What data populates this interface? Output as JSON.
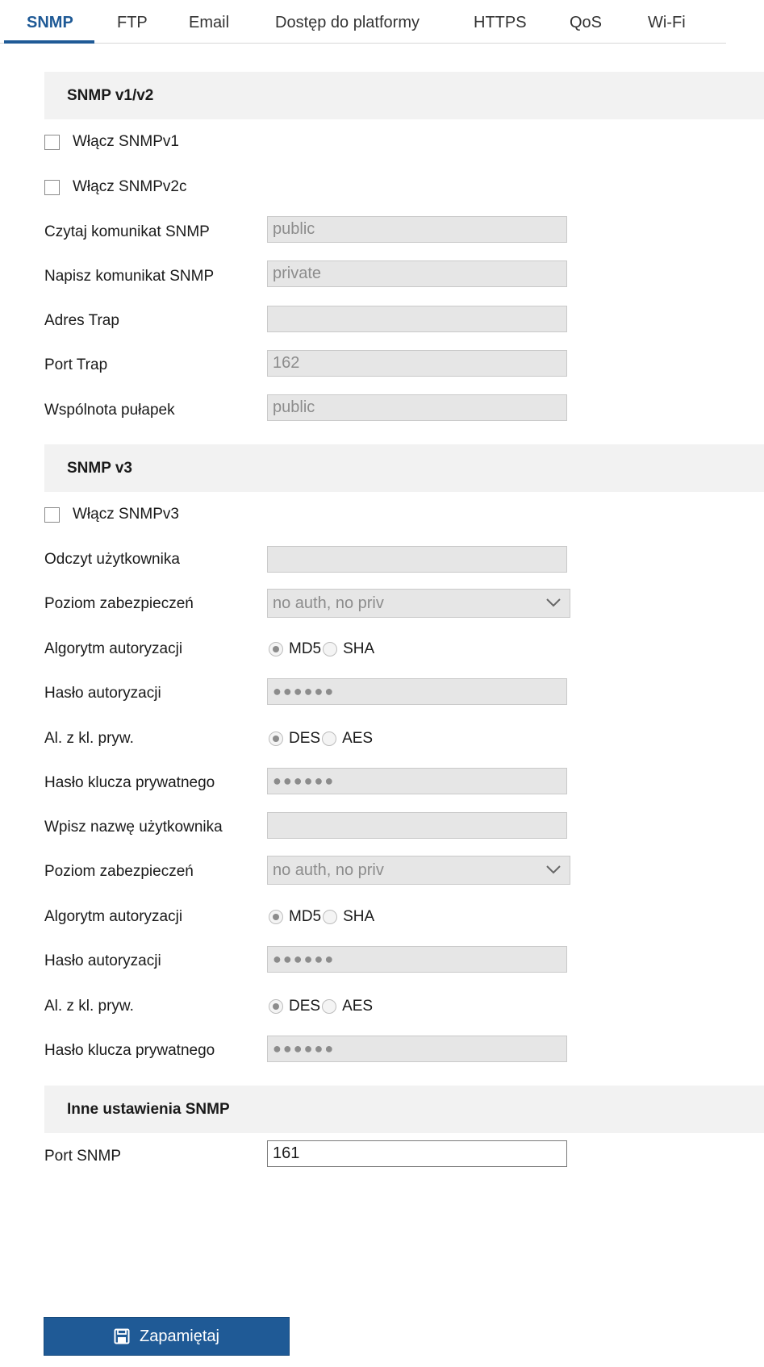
{
  "tabs": [
    {
      "label": "SNMP",
      "active": true
    },
    {
      "label": "FTP"
    },
    {
      "label": "Email"
    },
    {
      "label": "Dostęp do platformy"
    },
    {
      "label": "HTTPS"
    },
    {
      "label": "QoS"
    },
    {
      "label": "Wi-Fi"
    }
  ],
  "snmp_v1v2": {
    "title": "SNMP v1/v2",
    "enable_v1_label": "Włącz SNMPv1",
    "enable_v1_checked": false,
    "enable_v2c_label": "Włącz SNMPv2c",
    "enable_v2c_checked": false,
    "read_community_label": "Czytaj komunikat SNMP",
    "read_community_value": "public",
    "write_community_label": "Napisz komunikat SNMP",
    "write_community_value": "private",
    "trap_address_label": "Adres Trap",
    "trap_address_value": "",
    "trap_port_label": "Port Trap",
    "trap_port_value": "162",
    "trap_community_label": "Wspólnota pułapek",
    "trap_community_value": "public"
  },
  "snmp_v3": {
    "title": "SNMP v3",
    "enable_v3_label": "Włącz SNMPv3",
    "enable_v3_checked": false,
    "read_user": {
      "user_label": "Odczyt użytkownika",
      "user_value": "",
      "security_level_label": "Poziom zabezpieczeń",
      "security_level_value": "no auth, no priv",
      "auth_algorithm_label": "Algorytm autoryzacji",
      "auth_options": [
        "MD5",
        "SHA"
      ],
      "auth_selected": "MD5",
      "auth_password_label": "Hasło autoryzacji",
      "auth_password_value": "●●●●●●",
      "priv_algorithm_label": "Al. z kl. pryw.",
      "priv_options": [
        "DES",
        "AES"
      ],
      "priv_selected": "DES",
      "priv_password_label": "Hasło klucza prywatnego",
      "priv_password_value": "●●●●●●"
    },
    "write_user": {
      "user_label": "Wpisz nazwę użytkownika",
      "user_value": "",
      "security_level_label": "Poziom zabezpieczeń",
      "security_level_value": "no auth, no priv",
      "auth_algorithm_label": "Algorytm autoryzacji",
      "auth_options": [
        "MD5",
        "SHA"
      ],
      "auth_selected": "MD5",
      "auth_password_label": "Hasło autoryzacji",
      "auth_password_value": "●●●●●●",
      "priv_algorithm_label": "Al. z kl. pryw.",
      "priv_options": [
        "DES",
        "AES"
      ],
      "priv_selected": "DES",
      "priv_password_label": "Hasło klucza prywatnego",
      "priv_password_value": "●●●●●●"
    }
  },
  "other": {
    "title": "Inne ustawienia SNMP",
    "snmp_port_label": "Port SNMP",
    "snmp_port_value": "161"
  },
  "save_button": {
    "label": "Zapamiętaj",
    "icon": "save-icon"
  },
  "colors": {
    "accent": "#1f5a96",
    "section_bg": "#f2f2f2",
    "disabled_field": "#e6e6e6"
  }
}
